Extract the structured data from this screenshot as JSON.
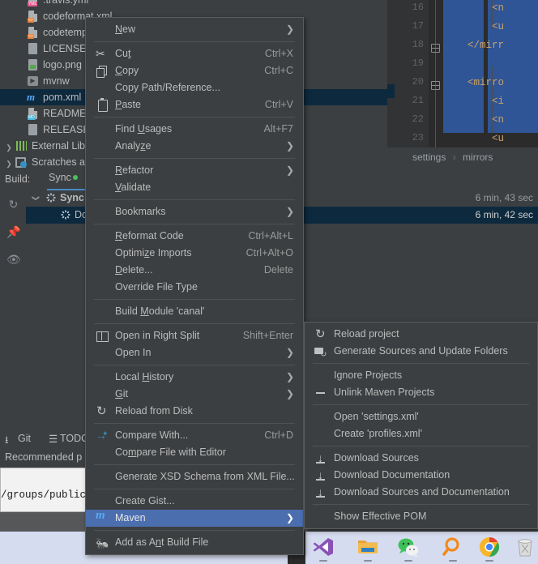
{
  "project_tree": {
    "items": [
      {
        "label": ".travis.yml",
        "icon": "yaml-file-icon",
        "indent": 0,
        "selected": false,
        "partial": true
      },
      {
        "label": "codeformat.xml",
        "icon": "xml-file-icon",
        "indent": 0,
        "selected": false
      },
      {
        "label": "codetemplate.xml",
        "icon": "xml-file-icon",
        "indent": 0,
        "selected": false
      },
      {
        "label": "LICENSE",
        "icon": "text-file-icon",
        "indent": 0,
        "selected": false
      },
      {
        "label": "logo.png",
        "icon": "image-file-icon",
        "indent": 0,
        "selected": false
      },
      {
        "label": "mvnw",
        "icon": "shell-file-icon",
        "indent": 0,
        "selected": false
      },
      {
        "label": "pom.xml",
        "icon": "maven-file-icon",
        "indent": 0,
        "selected": true
      },
      {
        "label": "README.md",
        "icon": "markdown-file-icon",
        "indent": 0,
        "selected": false
      },
      {
        "label": "RELEASE_NOTES.md",
        "icon": "text-file-icon",
        "indent": 0,
        "selected": false
      },
      {
        "label": "External Libraries",
        "icon": "libraries-icon",
        "indent": 0,
        "selected": false,
        "expandable": true
      },
      {
        "label": "Scratches and Consoles",
        "icon": "scratches-icon",
        "indent": 0,
        "selected": false,
        "expandable": true
      }
    ]
  },
  "editor": {
    "line_numbers": [
      "16",
      "17",
      "18",
      "19",
      "20",
      "21",
      "22",
      "23"
    ],
    "code_lines": [
      "        <n",
      "        <u",
      "    </mirr",
      "",
      "    <mirro",
      "        <i",
      "        <n",
      "        <u"
    ],
    "breadcrumb": [
      "settings",
      "mirrors"
    ],
    "breadcrumb_separator": "›"
  },
  "build_panel": {
    "title": "Build:",
    "tab_label": "Sync",
    "rows": [
      {
        "label": "Sync",
        "time": "6 min, 43 sec",
        "expanded": true,
        "selected": false,
        "bold": true
      },
      {
        "label": "Do",
        "time": "6 min, 42 sec",
        "expanded": false,
        "selected": true,
        "bold": false
      }
    ],
    "side_buttons": [
      "rerun-icon",
      "pin-icon",
      "eye-icon"
    ]
  },
  "bottom_bar": {
    "items": [
      {
        "label": "Git",
        "icon": "git-branch-icon"
      },
      {
        "label": "TODO",
        "icon": "todo-list-icon"
      }
    ],
    "status_text": "Recommended p"
  },
  "tip_box": {
    "text": "/groups/public/"
  },
  "context_menu": {
    "items": [
      {
        "label": "New",
        "mnemonic": "N",
        "icon": null,
        "shortcut": null,
        "submenu": true
      },
      {
        "type": "separator"
      },
      {
        "label": "Cut",
        "mnemonic": "t",
        "icon": "scissors-icon",
        "shortcut": "Ctrl+X",
        "submenu": false
      },
      {
        "label": "Copy",
        "mnemonic": "C",
        "icon": "copy-icon",
        "shortcut": "Ctrl+C",
        "submenu": false
      },
      {
        "label": "Copy Path/Reference...",
        "icon": null,
        "shortcut": null,
        "submenu": false
      },
      {
        "label": "Paste",
        "mnemonic": "P",
        "icon": "paste-icon",
        "shortcut": "Ctrl+V",
        "submenu": false
      },
      {
        "type": "separator"
      },
      {
        "label": "Find Usages",
        "mnemonic": "U",
        "icon": null,
        "shortcut": "Alt+F7",
        "submenu": false
      },
      {
        "label": "Analyze",
        "mnemonic": "z",
        "icon": null,
        "shortcut": null,
        "submenu": true
      },
      {
        "type": "separator"
      },
      {
        "label": "Refactor",
        "mnemonic": "R",
        "icon": null,
        "shortcut": null,
        "submenu": true
      },
      {
        "label": "Validate",
        "mnemonic": "V",
        "icon": null,
        "shortcut": null,
        "submenu": false
      },
      {
        "type": "separator"
      },
      {
        "label": "Bookmarks",
        "icon": null,
        "shortcut": null,
        "submenu": true
      },
      {
        "type": "separator"
      },
      {
        "label": "Reformat Code",
        "mnemonic": "R",
        "icon": null,
        "shortcut": "Ctrl+Alt+L",
        "submenu": false
      },
      {
        "label": "Optimize Imports",
        "mnemonic": "z",
        "icon": null,
        "shortcut": "Ctrl+Alt+O",
        "submenu": false
      },
      {
        "label": "Delete...",
        "mnemonic": "D",
        "icon": null,
        "shortcut": "Delete",
        "submenu": false
      },
      {
        "label": "Override File Type",
        "icon": null,
        "shortcut": null,
        "submenu": false
      },
      {
        "type": "separator"
      },
      {
        "label": "Build Module 'canal'",
        "mnemonic": "M",
        "icon": null,
        "shortcut": null,
        "submenu": false
      },
      {
        "type": "separator"
      },
      {
        "label": "Open in Right Split",
        "icon": "split-icon",
        "shortcut": "Shift+Enter",
        "submenu": false
      },
      {
        "label": "Open In",
        "icon": null,
        "shortcut": null,
        "submenu": true
      },
      {
        "type": "separator"
      },
      {
        "label": "Local History",
        "mnemonic": "H",
        "icon": null,
        "shortcut": null,
        "submenu": true
      },
      {
        "label": "Git",
        "mnemonic": "G",
        "icon": null,
        "shortcut": null,
        "submenu": true
      },
      {
        "label": "Reload from Disk",
        "icon": "reload-icon",
        "shortcut": null,
        "submenu": false
      },
      {
        "type": "separator"
      },
      {
        "label": "Compare With...",
        "icon": "compare-icon",
        "shortcut": "Ctrl+D",
        "submenu": false
      },
      {
        "label": "Compare File with Editor",
        "mnemonic": "m",
        "icon": null,
        "shortcut": null,
        "submenu": false
      },
      {
        "type": "separator"
      },
      {
        "label": "Generate XSD Schema from XML File...",
        "icon": null,
        "shortcut": null,
        "submenu": false
      },
      {
        "type": "separator"
      },
      {
        "label": "Create Gist...",
        "icon": "github-icon",
        "shortcut": null,
        "submenu": false
      },
      {
        "label": "Maven",
        "icon": "maven-icon",
        "shortcut": null,
        "submenu": true,
        "selected": true
      },
      {
        "type": "separator"
      },
      {
        "label": "Add as Ant Build File",
        "mnemonic": "n",
        "icon": "ant-icon",
        "shortcut": null,
        "submenu": false
      }
    ]
  },
  "maven_submenu": {
    "items": [
      {
        "label": "Reload project",
        "icon": "reload-icon"
      },
      {
        "label": "Generate Sources and Update Folders",
        "icon": "generate-folders-icon"
      },
      {
        "type": "separator"
      },
      {
        "label": "Ignore Projects",
        "icon": null
      },
      {
        "label": "Unlink Maven Projects",
        "icon": "minus-icon"
      },
      {
        "type": "separator"
      },
      {
        "label": "Open 'settings.xml'",
        "icon": null
      },
      {
        "label": "Create 'profiles.xml'",
        "icon": null
      },
      {
        "type": "separator"
      },
      {
        "label": "Download Sources",
        "icon": "download-icon"
      },
      {
        "label": "Download Documentation",
        "icon": "download-icon"
      },
      {
        "label": "Download Sources and Documentation",
        "icon": "download-icon"
      },
      {
        "type": "separator"
      },
      {
        "label": "Show Effective POM",
        "icon": null
      }
    ]
  },
  "taskbar": {
    "icons": [
      {
        "name": "visual-studio-icon"
      },
      {
        "name": "file-explorer-icon"
      },
      {
        "name": "wechat-icon"
      },
      {
        "name": "search-icon"
      },
      {
        "name": "chrome-icon"
      },
      {
        "name": "recycle-bin-icon"
      }
    ]
  },
  "colors": {
    "menu_bg": "#3c3f41",
    "menu_selection": "#4b6eaf",
    "tree_selection": "#0d293e",
    "editor_bg": "#2b2b2b",
    "editor_selection": "#2f5596",
    "accent_blue": "#56a8f5",
    "taskbar_bg": "#d6dcf0"
  }
}
